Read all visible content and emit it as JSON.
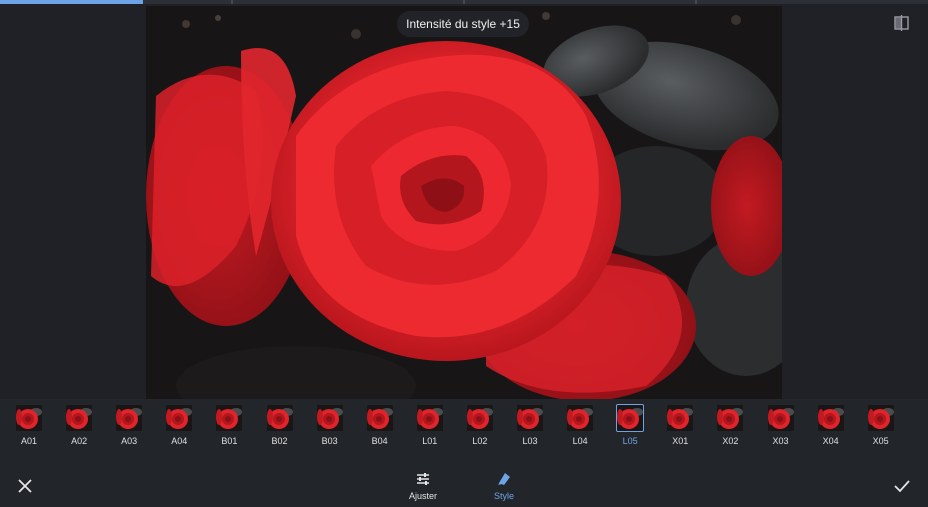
{
  "progress": {
    "fraction": 0.154
  },
  "preview": {
    "tooltip": "Intensité du style +15"
  },
  "compare_icon": "split-compare-icon",
  "styles": [
    {
      "label": "A01",
      "selected": false
    },
    {
      "label": "A02",
      "selected": false
    },
    {
      "label": "A03",
      "selected": false
    },
    {
      "label": "A04",
      "selected": false
    },
    {
      "label": "B01",
      "selected": false
    },
    {
      "label": "B02",
      "selected": false
    },
    {
      "label": "B03",
      "selected": false
    },
    {
      "label": "B04",
      "selected": false
    },
    {
      "label": "L01",
      "selected": false
    },
    {
      "label": "L02",
      "selected": false
    },
    {
      "label": "L03",
      "selected": false
    },
    {
      "label": "L04",
      "selected": false
    },
    {
      "label": "L05",
      "selected": true
    },
    {
      "label": "X01",
      "selected": false
    },
    {
      "label": "X02",
      "selected": false
    },
    {
      "label": "X03",
      "selected": false
    },
    {
      "label": "X04",
      "selected": false
    },
    {
      "label": "X05",
      "selected": false
    }
  ],
  "toolbar": {
    "cancel_icon": "close-icon",
    "confirm_icon": "check-icon",
    "tabs": [
      {
        "label": "Ajuster",
        "icon": "sliders-icon",
        "active": false
      },
      {
        "label": "Style",
        "icon": "brush-icon",
        "active": true
      }
    ]
  },
  "colors": {
    "accent": "#6fa3e8",
    "background": "#1f2126",
    "strip": "#22252a"
  }
}
